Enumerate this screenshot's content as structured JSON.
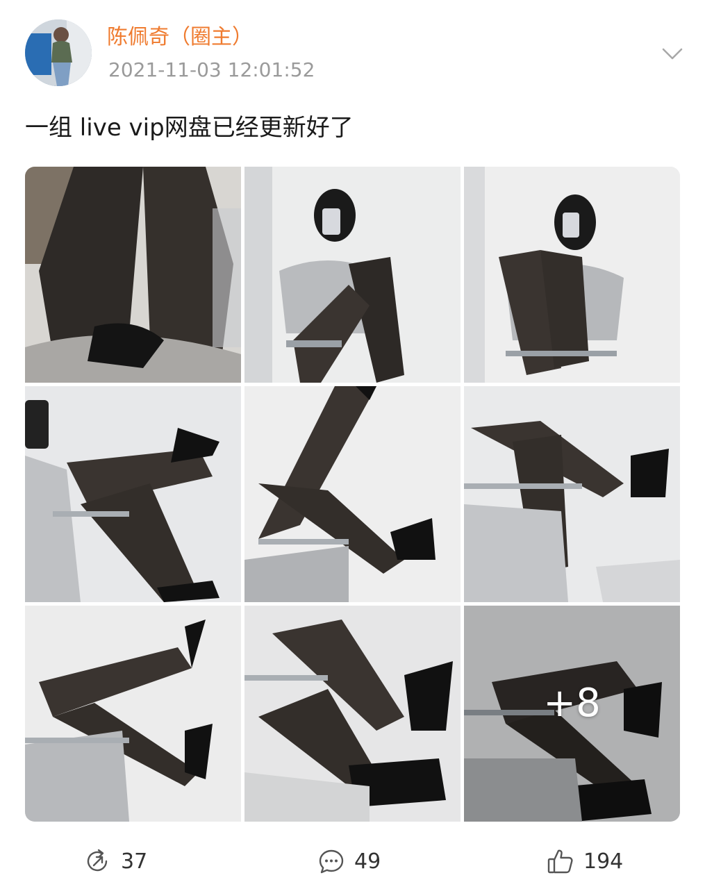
{
  "post": {
    "author_name": "陈佩奇（圈主）",
    "timestamp": "2021-11-03 12:01:52",
    "text": "一组 live vip网盘已经更新好了",
    "more_icon": "chevron-down-icon",
    "images_more_count": "+8"
  },
  "images": [
    {
      "name": "photo-1"
    },
    {
      "name": "photo-2"
    },
    {
      "name": "photo-3"
    },
    {
      "name": "photo-4"
    },
    {
      "name": "photo-5"
    },
    {
      "name": "photo-6"
    },
    {
      "name": "photo-7"
    },
    {
      "name": "photo-8"
    },
    {
      "name": "photo-9"
    }
  ],
  "actions": {
    "repost": {
      "icon": "repost-icon",
      "count": "37"
    },
    "comment": {
      "icon": "comment-icon",
      "count": "49"
    },
    "like": {
      "icon": "like-icon",
      "count": "194"
    }
  },
  "colors": {
    "author_name": "#ef7b2f",
    "timestamp": "#9a9a9a",
    "text": "#1a1a1a",
    "icon": "#555555"
  }
}
